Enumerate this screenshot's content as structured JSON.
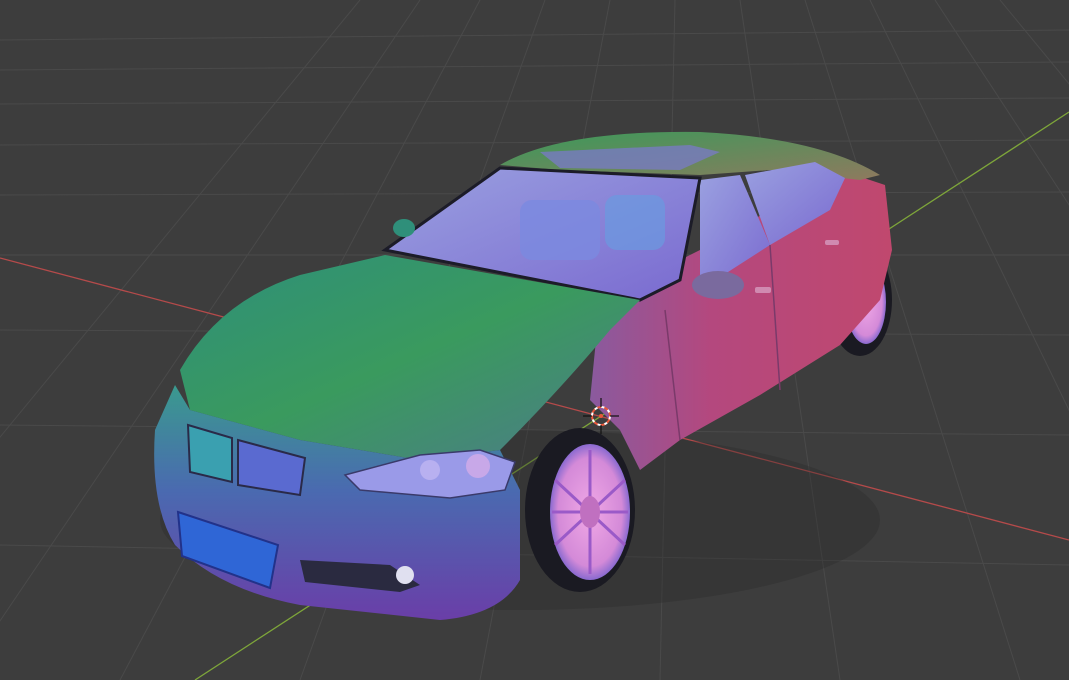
{
  "viewport": {
    "background": "#3d3d3d",
    "grid_color": "#4a4a4a",
    "x_axis_color": "#b54a4a",
    "y_axis_color": "#7ea63a",
    "cursor_color": "#e8583a"
  },
  "scene": {
    "object": "car",
    "shading": "normal-map",
    "colors": {
      "hood_green": "#2f8f6a",
      "roof_green": "#3f9a62",
      "side_magenta": "#b0447e",
      "front_blue": "#4e50b8",
      "plate_blue": "#2f66d6",
      "glass_lavender": "#8a8ad8",
      "tire": "#1a1a22",
      "rim": "#e8a0e0"
    }
  }
}
